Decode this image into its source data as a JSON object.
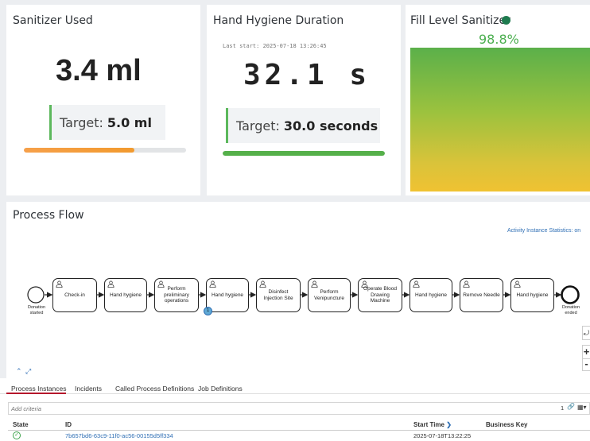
{
  "sanitizer_panel": {
    "title": "Sanitizer Used",
    "value": "3.4 ml",
    "target_label": "Target:",
    "target_value": "5.0 ml",
    "progress_fraction": 0.68,
    "bar_color": "#f0a040"
  },
  "hygiene_panel": {
    "title": "Hand Hygiene Duration",
    "last_start": "Last start: 2025-07-18 13:26:45",
    "value": "32.1 s",
    "target_label": "Target:",
    "target_value": "30.0 seconds",
    "progress_fraction": 1.0,
    "bar_color": "#55b04a"
  },
  "fill_panel": {
    "title": "Fill Level Sanitizer",
    "value": "98.8%",
    "fill_fraction": 0.988,
    "status_color": "#1e7b4f",
    "value_color": "#4caf50"
  },
  "process_flow": {
    "title": "Process Flow",
    "statistics_link": "Activity Instance Statistics: on",
    "start_event": "Donation started",
    "end_event": "Donation ended",
    "tasks": [
      {
        "label": "Check-in"
      },
      {
        "label": "Hand hygiene"
      },
      {
        "label": "Perform preliminary operations"
      },
      {
        "label": "Hand hygiene",
        "badge": "1"
      },
      {
        "label": "Disinfect Injection Site"
      },
      {
        "label": "Perform Venipuncture"
      },
      {
        "label": "Operate Blood Drawing Machine"
      },
      {
        "label": "Hand hygiene"
      },
      {
        "label": "Remove Needle"
      },
      {
        "label": "Hand hygiene"
      }
    ]
  },
  "tabs": [
    {
      "label": "Process Instances",
      "active": true
    },
    {
      "label": "Incidents"
    },
    {
      "label": "Called Process Definitions"
    },
    {
      "label": "Job Definitions"
    }
  ],
  "filter": {
    "placeholder": "Add criteria",
    "count": "1"
  },
  "table": {
    "headers": {
      "state": "State",
      "id": "ID",
      "start_time": "Start Time",
      "business_key": "Business Key"
    },
    "rows": [
      {
        "state_icon": "check-circle-icon",
        "id": "7b657bd6-63c9-11f0-ac56-00155d5ff334",
        "start_time": "2025-07-18T13:22:25",
        "business_key": ""
      }
    ]
  }
}
